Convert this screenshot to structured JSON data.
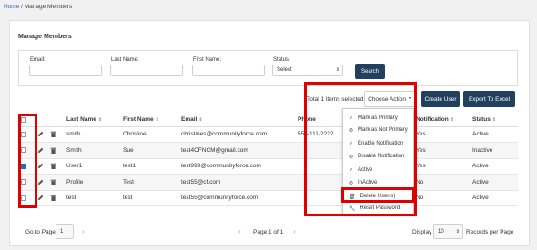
{
  "breadcrumb": {
    "home": "Home",
    "separator": " / ",
    "current": "Manage Members"
  },
  "panel": {
    "title": "Manage Members"
  },
  "filters": {
    "email_label": "Email:",
    "last_name_label": "Last Name:",
    "first_name_label": "First Name:",
    "status_label": "Status:",
    "status_value": "Select",
    "search_label": "Search"
  },
  "toolbar": {
    "selected_text": "Total 1 items selected",
    "choose_action_label": "Choose Action",
    "create_user_label": "Create User",
    "export_label": "Export To Excel"
  },
  "action_menu": [
    {
      "icon": "check-icon",
      "label": "Mark as Primary"
    },
    {
      "icon": "ban-icon",
      "label": "Mark as Not Primary"
    },
    {
      "icon": "check-icon",
      "label": "Enable Notification"
    },
    {
      "icon": "ban-icon",
      "label": "Disable Notification"
    },
    {
      "icon": "check-icon",
      "label": "Active"
    },
    {
      "icon": "ban-icon",
      "label": "InActive"
    },
    {
      "icon": "trash-icon",
      "label": "Delete User(s)"
    },
    {
      "icon": "wrench-icon",
      "label": "Reset Password"
    }
  ],
  "table": {
    "headers": [
      "Last Name",
      "First Name",
      "Email",
      "Phone",
      "Notification",
      "Status"
    ],
    "rows": [
      {
        "last": "smith",
        "first": "Christine",
        "email": "christines@communityforce.com",
        "phone": "555-111-2222",
        "notification": "Yes",
        "status": "Active",
        "checked": false
      },
      {
        "last": "Smith",
        "first": "Sue",
        "email": "test4CFNCM@gmail.com",
        "phone": "",
        "notification": "Yes",
        "status": "Inactive",
        "checked": false
      },
      {
        "last": "User1",
        "first": "test1",
        "email": "test999@communityforce.com",
        "phone": "",
        "notification": "Yes",
        "status": "Active",
        "checked": true
      },
      {
        "last": "Profile",
        "first": "Test",
        "email": "test55@cf.com",
        "phone": "",
        "notification": "No",
        "status": "Active",
        "checked": false
      },
      {
        "last": "test",
        "first": "test",
        "email": "test55@communityforce.com",
        "phone": "",
        "notification": "No",
        "status": "Active",
        "checked": false
      }
    ]
  },
  "footer": {
    "go_to_page_label": "Go to Page",
    "page_value": "1",
    "page_of": "Page 1 of 1",
    "display_label": "Display",
    "display_value": "10",
    "records_label": "Records per Page"
  },
  "colors": {
    "accent_dark": "#22405e",
    "highlight": "#e00000",
    "link": "#2a6ebb"
  }
}
